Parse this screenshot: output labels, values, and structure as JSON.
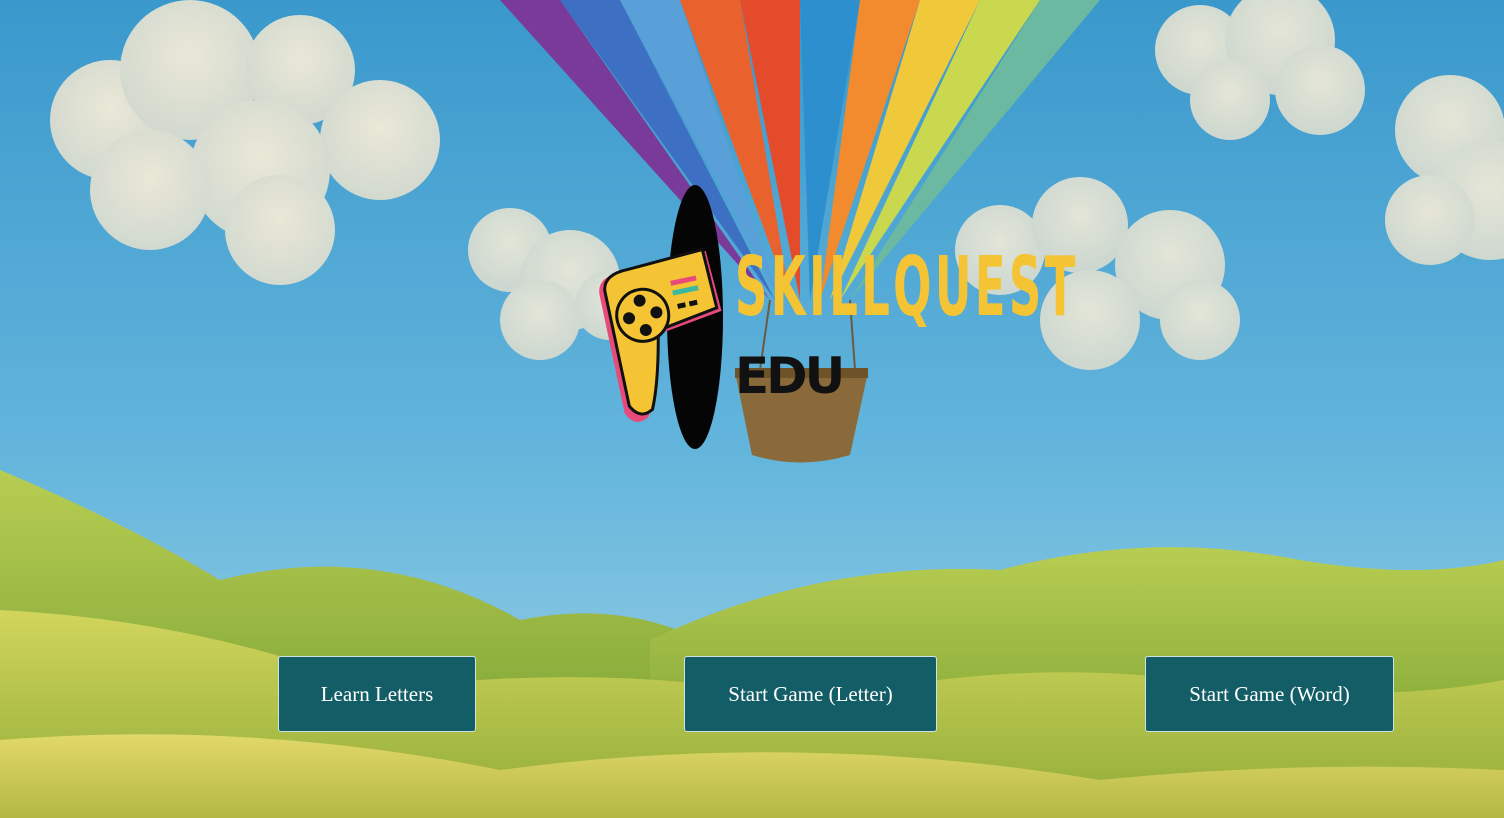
{
  "logo": {
    "title": "SKILLQUEST",
    "subtitle": "EDU"
  },
  "buttons": {
    "learn_letters": "Learn Letters",
    "start_game_letter": "Start Game (Letter)",
    "start_game_word": "Start Game (Word)"
  },
  "colors": {
    "button_bg": "#135e66",
    "button_text": "#ffffff",
    "logo_yellow": "#f4c434",
    "sky": "#3f9fd0",
    "hills": "#a8c43c"
  },
  "background": {
    "icon": "hot-air-balloon-landscape"
  }
}
